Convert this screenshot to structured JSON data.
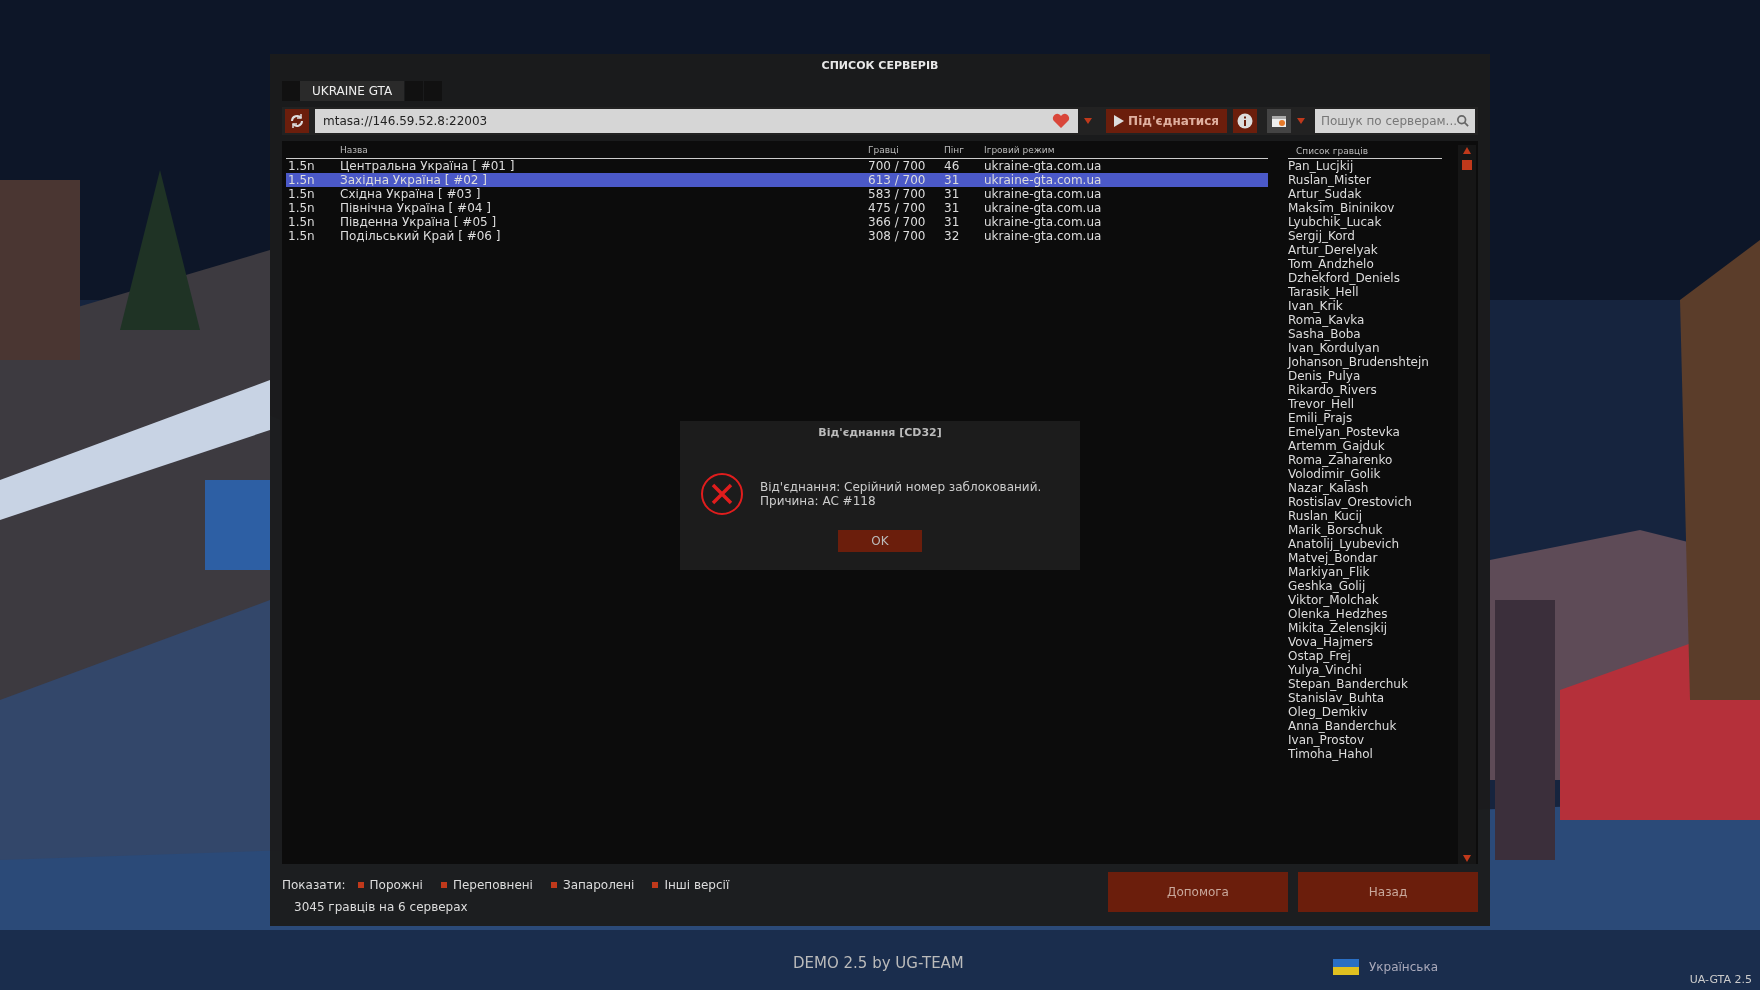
{
  "window": {
    "title": "СПИСОК СЕРВЕРІВ"
  },
  "tabs": [
    {
      "label": "UKRAINE GTA",
      "selected": true
    }
  ],
  "toolbar": {
    "address": "mtasa://146.59.52.8:22003",
    "favorite": true,
    "connect_button": "Під'єднатися",
    "search": {
      "placeholder": "Пошук по серверам..."
    }
  },
  "servers": {
    "columns": [
      "Назва",
      "Гравці",
      "Пінг",
      "Ігровий режим"
    ],
    "rows": [
      {
        "version": "1.5n",
        "name": "Центральна Україна [ #01 ]",
        "players": "700 / 700",
        "ping": "46",
        "gamemode": "ukraine-gta.com.ua",
        "selected": false
      },
      {
        "version": "1.5n",
        "name": "Західна Україна [ #02 ]",
        "players": "613 / 700",
        "ping": "31",
        "gamemode": "ukraine-gta.com.ua",
        "selected": true
      },
      {
        "version": "1.5n",
        "name": "Східна Україна [ #03 ]",
        "players": "583 / 700",
        "ping": "31",
        "gamemode": "ukraine-gta.com.ua",
        "selected": false
      },
      {
        "version": "1.5n",
        "name": "Північна Україна [ #04 ]",
        "players": "475 / 700",
        "ping": "31",
        "gamemode": "ukraine-gta.com.ua",
        "selected": false
      },
      {
        "version": "1.5n",
        "name": "Південна Україна [ #05 ]",
        "players": "366 / 700",
        "ping": "31",
        "gamemode": "ukraine-gta.com.ua",
        "selected": false
      },
      {
        "version": "1.5n",
        "name": "Подільський Край [ #06 ]",
        "players": "308 / 700",
        "ping": "32",
        "gamemode": "ukraine-gta.com.ua",
        "selected": false
      }
    ]
  },
  "players": {
    "title": "Список гравців",
    "names": [
      "Pan_Lucjkij",
      "Ruslan_Mister",
      "Artur_Sudak",
      "Maksim_Bininikov",
      "Lyubchik_Lucak",
      "Sergij_Kord",
      "Artur_Derelyak",
      "Tom_Andzhelo",
      "Dzhekford_Deniels",
      "Tarasik_Hell",
      "Ivan_Krik",
      "Roma_Kavka",
      "Sasha_Boba",
      "Ivan_Kordulyan",
      "Johanson_Brudenshtejn",
      "Denis_Pulya",
      "Rikardo_Rivers",
      "Trevor_Hell",
      "Emili_Prajs",
      "Emelyan_Postevka",
      "Artemm_Gajduk",
      "Roma_Zaharenko",
      "Volodimir_Golik",
      "Nazar_Kalash",
      "Rostislav_Orestovich",
      "Ruslan_Kucij",
      "Marik_Borschuk",
      "Anatolij_Lyubevich",
      "Matvej_Bondar",
      "Markiyan_Flik",
      "Geshka_Golij",
      "Viktor_Molchak",
      "Olenka_Hedzhes",
      "Mikita_Zelensjkij",
      "Vova_Hajmers",
      "Ostap_Frej",
      "Yulya_Vinchi",
      "Stepan_Banderchuk",
      "Stanislav_Buhta",
      "Oleg_Demkiv",
      "Anna_Banderchuk",
      "Ivan_Prostov",
      "Timoha_Hahol"
    ]
  },
  "filters": {
    "label": "Показати:",
    "options": [
      {
        "label": "Порожні",
        "checked": true
      },
      {
        "label": "Переповнені",
        "checked": true
      },
      {
        "label": "Запаролені",
        "checked": true
      },
      {
        "label": "Інші версії",
        "checked": true
      }
    ]
  },
  "summary": "3045 гравців на 6 серверах",
  "buttons": [
    "Допомога",
    "Назад"
  ],
  "dialog": {
    "title": "Від'єднання [CD32]",
    "lines": [
      "Від'єднання: Серійний номер заблокований.",
      "Причина: AC #118"
    ],
    "button": "OK"
  },
  "footer": {
    "credit": "DEMO 2.5 by UG-TEAM",
    "language": "Українська",
    "version": "UA-GTA 2.5"
  }
}
